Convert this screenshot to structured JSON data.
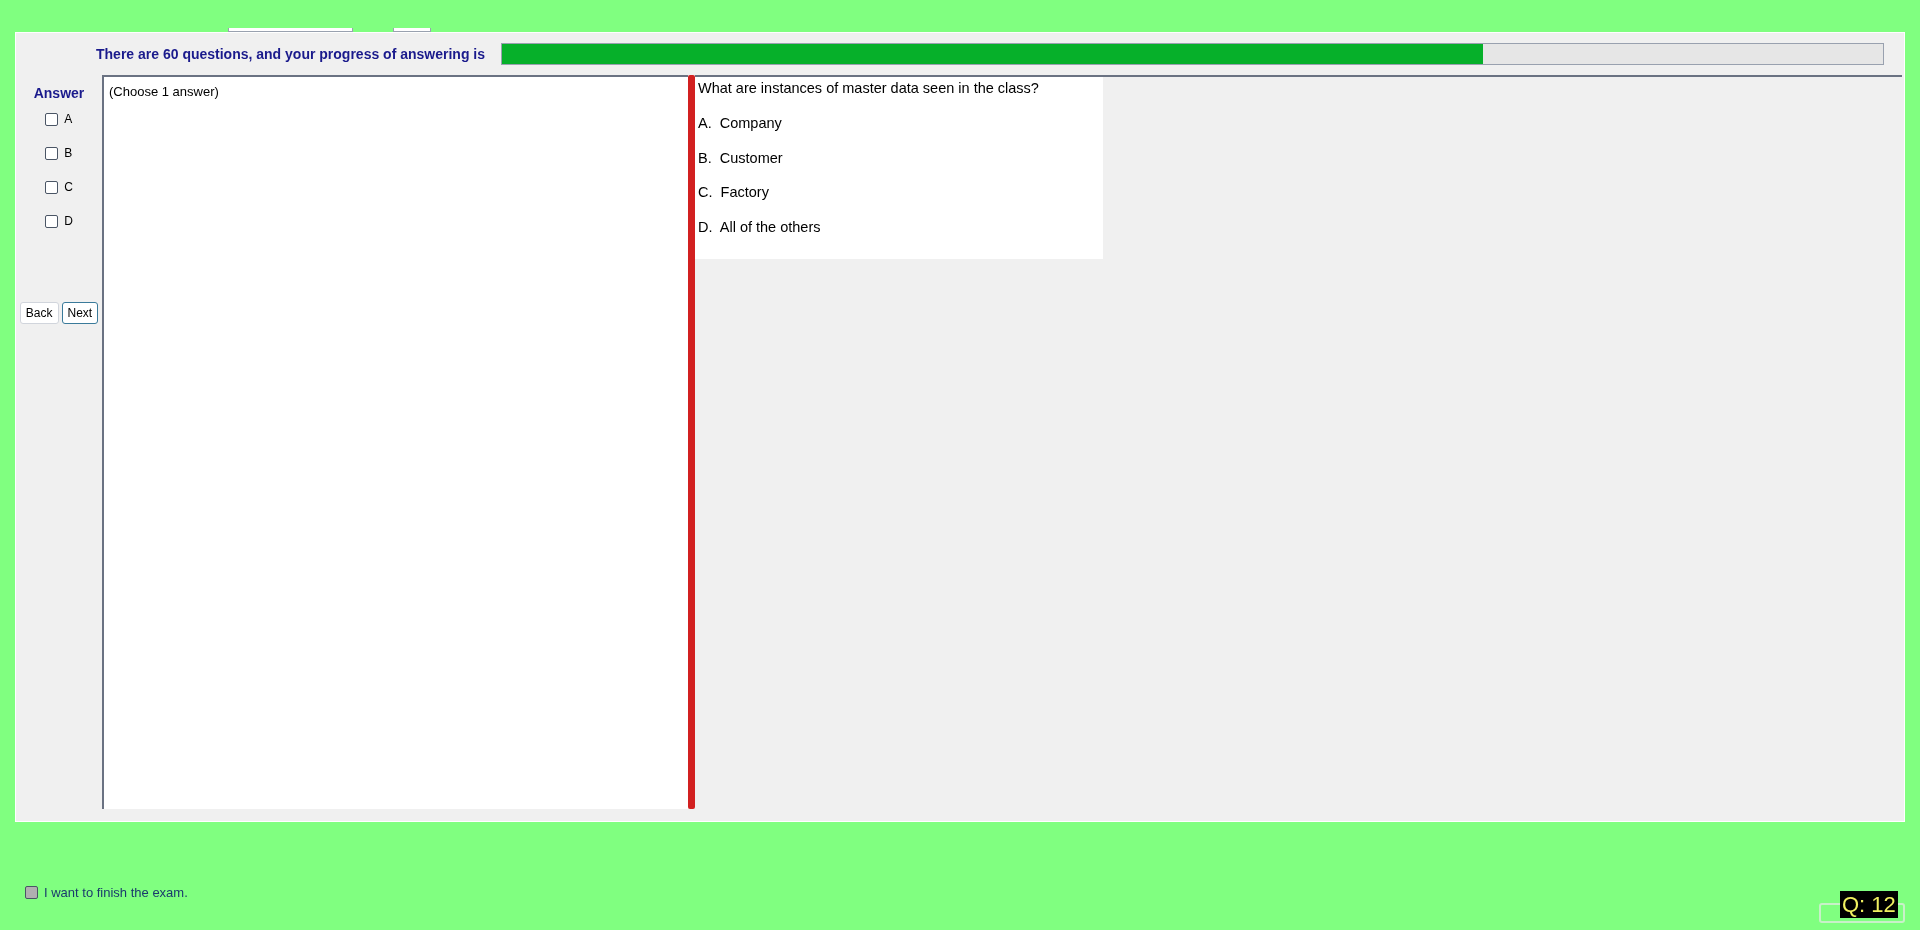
{
  "progress": {
    "label": "There are 60 questions, and your progress of answering is",
    "level": 0.71
  },
  "answer_panel": {
    "title": "Answer",
    "options": [
      {
        "label": "A",
        "checked": false
      },
      {
        "label": "B",
        "checked": false
      },
      {
        "label": "C",
        "checked": false
      },
      {
        "label": "D",
        "checked": false
      }
    ],
    "buttons": [
      {
        "label": "Back",
        "selected": false
      },
      {
        "label": "Next",
        "selected": true
      }
    ]
  },
  "answer_box": {
    "hint": "(Choose 1 answer)"
  },
  "question": {
    "text": "What are instances of master data seen in the class?",
    "choices": [
      "A.  Company",
      "B.  Customer",
      "C.  Factory",
      "D.  All of the others"
    ]
  },
  "finish": {
    "label": "I want to finish the exam.",
    "checked": false
  },
  "question_number": "Q: 12"
}
